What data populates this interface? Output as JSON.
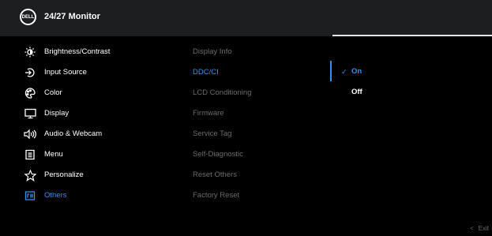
{
  "header": {
    "logo_text": "DELL",
    "title": "24/27 Monitor"
  },
  "menu": [
    {
      "label": "Brightness/Contrast",
      "icon": "brightness-icon"
    },
    {
      "label": "Input Source",
      "icon": "input-source-icon"
    },
    {
      "label": "Color",
      "icon": "color-palette-icon"
    },
    {
      "label": "Display",
      "icon": "display-icon"
    },
    {
      "label": "Audio & Webcam",
      "icon": "speaker-icon"
    },
    {
      "label": "Menu",
      "icon": "menu-list-icon"
    },
    {
      "label": "Personalize",
      "icon": "star-icon"
    },
    {
      "label": "Others",
      "icon": "others-icon",
      "active": true
    }
  ],
  "submenu": [
    {
      "label": "Display Info"
    },
    {
      "label": "DDC/CI",
      "active": true
    },
    {
      "label": "LCD Conditioning"
    },
    {
      "label": "Firmware"
    },
    {
      "label": "Service Tag"
    },
    {
      "label": "Self-Diagnostic"
    },
    {
      "label": "Reset Others"
    },
    {
      "label": "Factory Reset"
    }
  ],
  "options": [
    {
      "label": "On",
      "selected": true
    },
    {
      "label": "Off",
      "selected": false
    }
  ],
  "footer": {
    "exit_label": "Exit"
  },
  "colors": {
    "accent": "#3a8ee6",
    "header_bg": "#1d1e20",
    "dim_text": "#6b6b6b"
  }
}
